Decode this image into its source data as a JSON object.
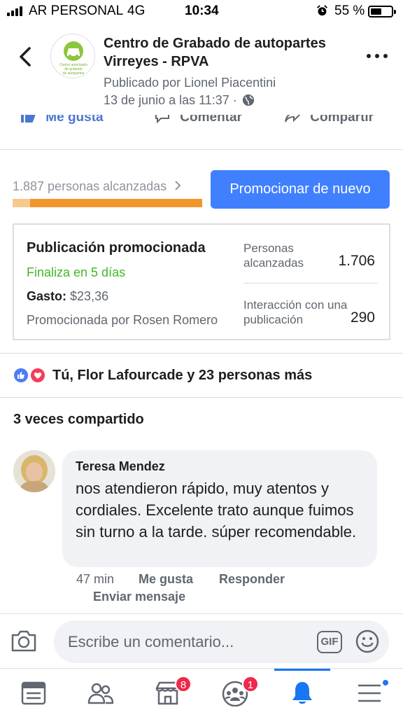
{
  "status_bar": {
    "carrier": "AR PERSONAL",
    "network": "4G",
    "time": "10:34",
    "battery_percent": "55 %",
    "battery_level": 0.55
  },
  "header": {
    "page_name": "Centro de Grabado de autopartes Virreyes - RPVA",
    "posted_by": "Publicado por Lionel Piacentini",
    "date": "13 de junio a las 11:37 ·",
    "logo_text": [
      "Centro autorizado",
      "de grabado",
      "de autopartes"
    ]
  },
  "actions": {
    "like": "Me gusta",
    "comment": "Comentar",
    "share": "Compartir"
  },
  "promotion": {
    "reach_text": "1.887 personas alcanzadas",
    "promote_button": "Promocionar de nuevo",
    "card_title": "Publicación promocionada",
    "ends": "Finaliza en 5 días",
    "spend_label": "Gasto:",
    "spend_value": "$23,36",
    "promoted_by": "Promocionada por Rosen Romero",
    "stats": [
      {
        "label": "Personas alcanzadas",
        "value": "1.706"
      },
      {
        "label": "Interacción con una publicación",
        "value": "290"
      }
    ]
  },
  "reactions": {
    "text": "Tú, Flor Lafourcade y 23 personas más"
  },
  "shares": "3 veces compartido",
  "comment": {
    "author": "Teresa Mendez",
    "text": "nos atendieron rápido, muy atentos y cordiales. Excelente trato aunque fuimos sin turno  a la tarde. súper recomendable.",
    "time": "47 min",
    "like": "Me gusta",
    "reply": "Responder",
    "message": "Enviar mensaje"
  },
  "composer": {
    "placeholder": "Escribe un comentario...",
    "gif": "GIF"
  },
  "tab_bar": {
    "marketplace_badge": "8",
    "groups_badge": "1",
    "accent_color": "#1877f2"
  },
  "colors": {
    "promote_button": "#4080ff",
    "ends_green": "#42b72a",
    "reach_bar": "#f2962c",
    "badge": "#f02849"
  }
}
